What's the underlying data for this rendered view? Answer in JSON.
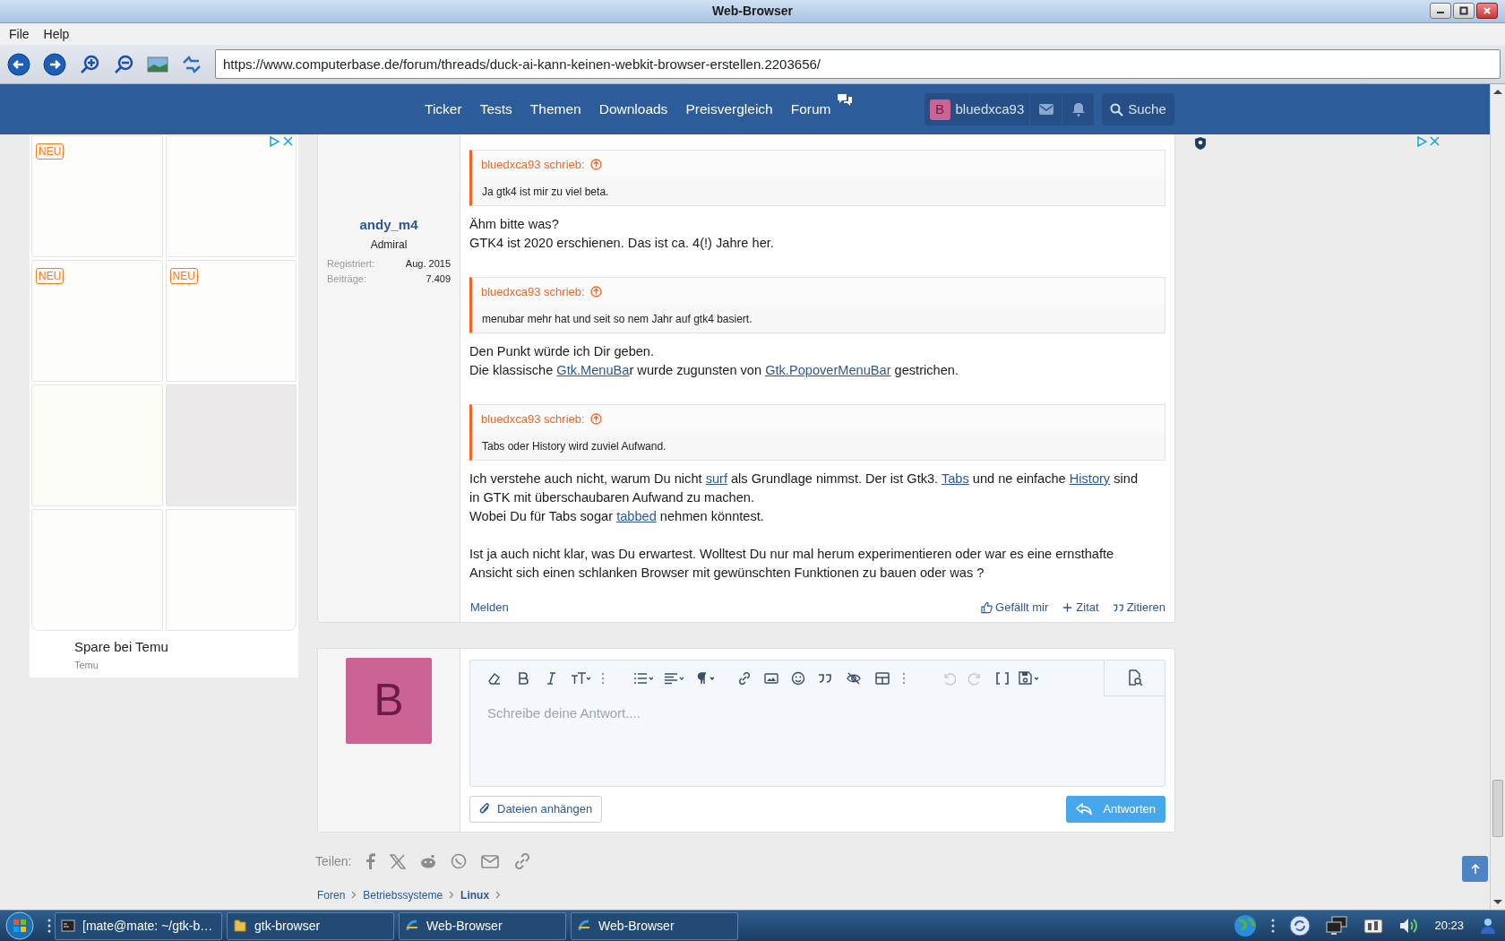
{
  "window": {
    "title": "Web-Browser"
  },
  "menu": [
    "File",
    "Help"
  ],
  "address_bar": {
    "value": "https://www.computerbase.de/forum/threads/duck-ai-kann-keinen-webkit-browser-erstellen.2203656/"
  },
  "site_nav": [
    "Ticker",
    "Tests",
    "Themen",
    "Downloads",
    "Preisvergleich",
    "Forum"
  ],
  "account": {
    "initial": "B",
    "name": "bluedxca93"
  },
  "search": {
    "label": "Suche"
  },
  "ad": {
    "tiles": [
      {
        "kind": "plain",
        "badge": "NEU"
      },
      {
        "kind": "plain"
      },
      {
        "kind": "plain",
        "badge": "NEU"
      },
      {
        "kind": "plain",
        "badge": "NEU"
      },
      {
        "kind": "cream"
      },
      {
        "kind": "grey"
      },
      {
        "kind": "plain"
      },
      {
        "kind": "plain"
      }
    ],
    "title": "Spare bei Temu",
    "advertiser": "Temu"
  },
  "post": {
    "author": "andy_m4",
    "role": "Admiral",
    "stats": [
      {
        "label": "Registriert:",
        "value": "Aug. 2015"
      },
      {
        "label": "Beiträge:",
        "value": "7.409"
      }
    ],
    "blocks": [
      {
        "kind": "quote",
        "author": "bluedxca93 schrieb:",
        "text": "Ja gtk4 ist mir zu viel beta."
      },
      {
        "kind": "paragraph",
        "lines": [
          [
            {
              "text": "Ähm bitte was?"
            }
          ],
          [
            {
              "text": "GTK4 ist 2020 erschienen. Das ist ca. 4(!) Jahre her."
            }
          ]
        ]
      },
      {
        "kind": "quote",
        "author": "bluedxca93 schrieb:",
        "text": "menubar mehr hat und seit so nem Jahr auf gtk4 basiert."
      },
      {
        "kind": "paragraph",
        "lines": [
          [
            {
              "text": "Den Punkt würde ich Dir geben."
            }
          ],
          [
            {
              "text": "Die klassische "
            },
            {
              "text": "Gtk.MenuBa",
              "link": true
            },
            {
              "text": "r wurde zugunsten von "
            },
            {
              "text": "Gtk.PopoverMenuBar",
              "link": true
            },
            {
              "text": " gestrichen."
            }
          ]
        ]
      },
      {
        "kind": "quote",
        "author": "bluedxca93 schrieb:",
        "text": "Tabs oder History wird zuviel Aufwand."
      },
      {
        "kind": "paragraph",
        "lines": [
          [
            {
              "text": "Ich verstehe auch nicht, warum Du nicht "
            },
            {
              "text": "surf",
              "link": true
            },
            {
              "text": " als Grundlage nimmst. Der ist Gtk3. "
            },
            {
              "text": "Tabs",
              "link": true
            },
            {
              "text": " und ne einfache "
            },
            {
              "text": "History",
              "link": true
            },
            {
              "text": " sind"
            }
          ],
          [
            {
              "text": "in GTK mit überschaubaren Aufwand zu machen."
            }
          ],
          [
            {
              "text": "Wobei Du für Tabs sogar "
            },
            {
              "text": "tabbed",
              "link": true
            },
            {
              "text": " nehmen könntest."
            }
          ]
        ]
      },
      {
        "kind": "paragraph",
        "lines": [
          [
            {
              "text": "Ist ja auch nicht klar, was Du erwartest. Wolltest Du nur mal herum experimentieren oder war es eine ernsthafte"
            }
          ],
          [
            {
              "text": "Ansicht sich einen schlanken Browser mit gewünschten Funktionen zu bauen oder was ?"
            }
          ]
        ]
      }
    ],
    "report": "Melden",
    "actions": [
      "Gefällt mir",
      "Zitat",
      "Zitieren"
    ]
  },
  "reply": {
    "avatar_initial": "B",
    "placeholder": "Schreibe deine Antwort....",
    "attach": "Dateien anhängen",
    "submit": "Antworten"
  },
  "share": {
    "label": "Teilen:"
  },
  "breadcrumb": [
    {
      "text": "Foren",
      "current": false
    },
    {
      "text": "Betriebssysteme",
      "current": false
    },
    {
      "text": "Linux",
      "current": true
    }
  ],
  "taskbar": {
    "items": [
      {
        "kind": "terminal",
        "label": "[mate@mate: ~/gtk-b…"
      },
      {
        "kind": "folder",
        "label": "gtk-browser"
      },
      {
        "kind": "browser",
        "label": "Web-Browser"
      },
      {
        "kind": "browser",
        "label": "Web-Browser"
      }
    ],
    "clock": "20:23"
  }
}
